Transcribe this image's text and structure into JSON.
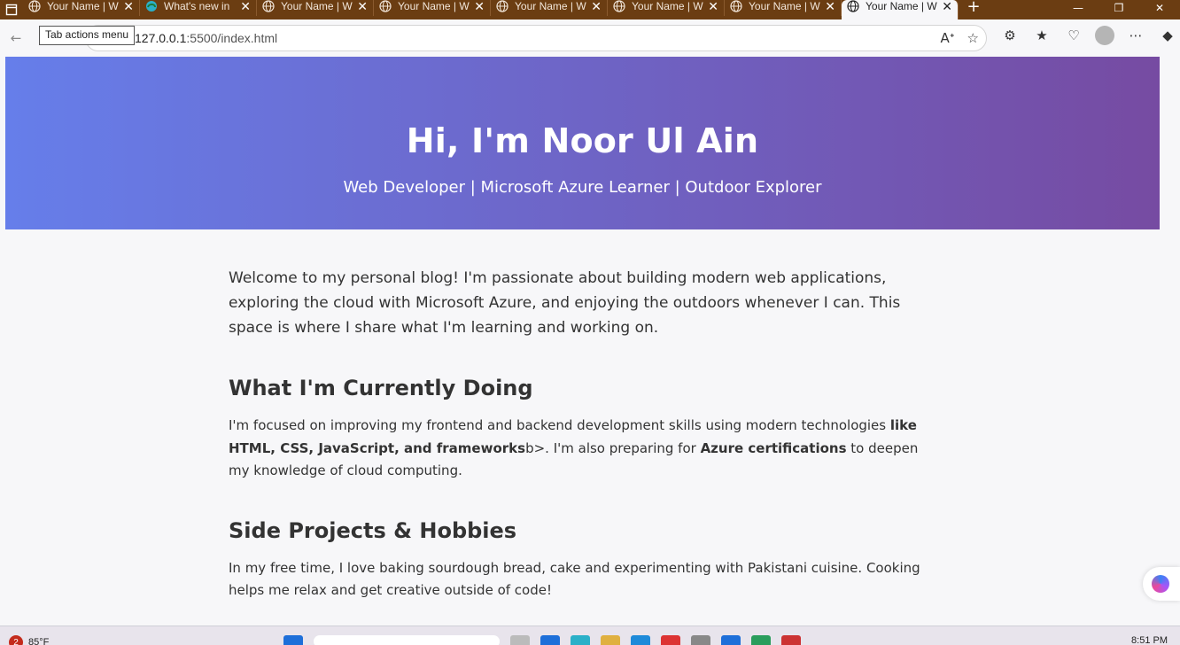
{
  "browser": {
    "tabs": [
      {
        "label": "Your Name | W",
        "active": false
      },
      {
        "label": "What's new in",
        "active": false
      },
      {
        "label": "Your Name | W",
        "active": false
      },
      {
        "label": "Your Name | W",
        "active": false
      },
      {
        "label": "Your Name | W",
        "active": false
      },
      {
        "label": "Your Name | W",
        "active": false
      },
      {
        "label": "Your Name | W",
        "active": false
      },
      {
        "label": "Your Name | W",
        "active": true
      }
    ],
    "tooltip": "Tab actions menu",
    "url_host": "127.0.0.1",
    "url_path": ":5500/index.html"
  },
  "hero": {
    "title": "Hi, I'm Noor Ul Ain",
    "subtitle": "Web Developer | Microsoft Azure Learner | Outdoor Explorer",
    "gradient_start": "#667eea",
    "gradient_end": "#764ba2"
  },
  "main": {
    "intro": "Welcome to my personal blog! I'm passionate about building modern web applications, exploring the cloud with Microsoft Azure, and enjoying the outdoors whenever I can. This space is where I share what I'm learning and working on.",
    "section1": {
      "heading": "What I'm Currently Doing",
      "text_a": "I'm focused on improving my frontend and backend development skills using modern technologies ",
      "bold_a": "like HTML, CSS, JavaScript, and frameworks",
      "text_b": "b>. I'm also preparing for ",
      "bold_b": "Azure certifications",
      "text_c": " to deepen my knowledge of cloud computing."
    },
    "section2": {
      "heading": "Side Projects & Hobbies",
      "text": "In my free time, I love baking sourdough bread, cake and experimenting with Pakistani cuisine. Cooking helps me relax and get creative outside of code!"
    }
  },
  "taskbar": {
    "notification_count": "2",
    "temperature": "85°F",
    "time": "8:51 PM"
  }
}
